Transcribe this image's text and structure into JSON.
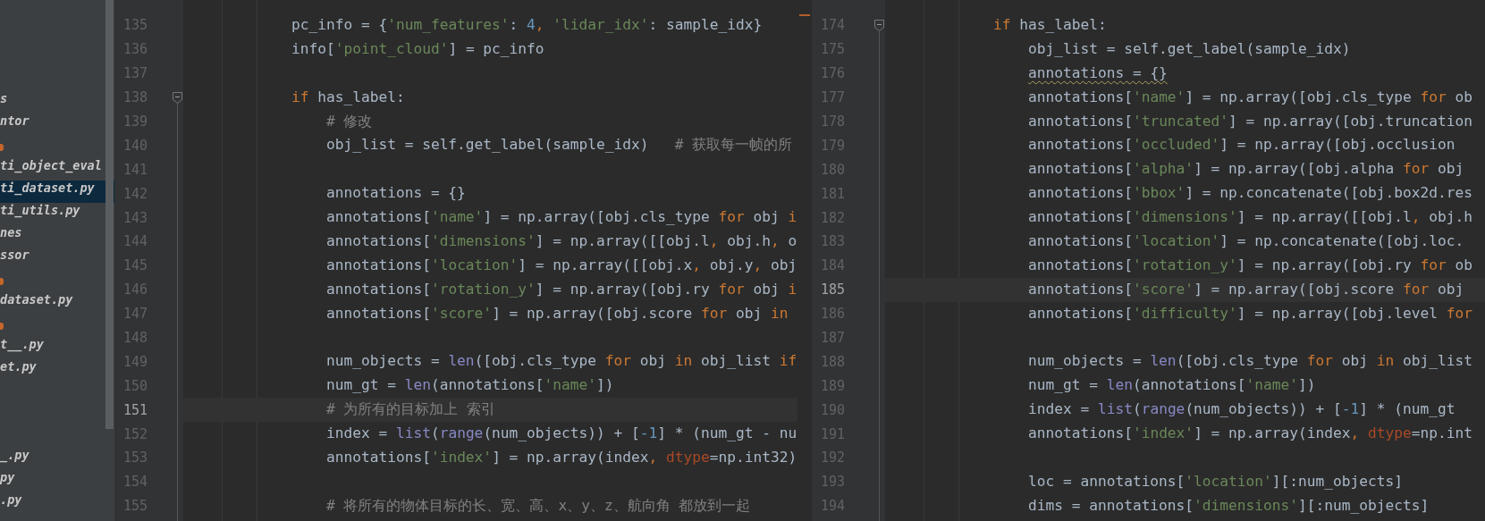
{
  "sidebar": {
    "groups": [
      {
        "items": [
          {
            "kind": "file",
            "label": "s",
            "selected": false
          },
          {
            "kind": "file",
            "label": "ntor",
            "selected": false
          },
          {
            "kind": "marker"
          },
          {
            "kind": "file",
            "label": "ti_object_eval",
            "selected": false
          },
          {
            "kind": "file",
            "label": "ti_dataset.py",
            "selected": true
          },
          {
            "kind": "file",
            "label": "ti_utils.py",
            "selected": false
          },
          {
            "kind": "file",
            "label": "nes",
            "selected": false
          },
          {
            "kind": "file",
            "label": "ssor",
            "selected": false
          },
          {
            "kind": "marker"
          },
          {
            "kind": "file",
            "label": "dataset.py",
            "selected": false
          },
          {
            "kind": "marker"
          },
          {
            "kind": "file",
            "label": "t__.py",
            "selected": false
          },
          {
            "kind": "file",
            "label": "et.py",
            "selected": false
          }
        ]
      },
      {
        "items": [
          {
            "kind": "file",
            "label": "_.py",
            "selected": false
          },
          {
            "kind": "file",
            "label": "py",
            "selected": false
          },
          {
            "kind": "file",
            "label": ".py",
            "selected": false
          }
        ]
      }
    ]
  },
  "panes": [
    {
      "lines": [
        {
          "number": "135",
          "current": false,
          "fold": false,
          "segments": [
            {
              "text": "            pc_info = {",
              "kind": "plain"
            },
            {
              "text": "'num_features'",
              "kind": "string"
            },
            {
              "text": ": ",
              "kind": "plain"
            },
            {
              "text": "4",
              "kind": "number"
            },
            {
              "text": ", ",
              "kind": "keyword"
            },
            {
              "text": "'lidar_idx'",
              "kind": "string"
            },
            {
              "text": ": sample_idx}",
              "kind": "plain"
            }
          ]
        },
        {
          "number": "136",
          "current": false,
          "fold": false,
          "segments": [
            {
              "text": "            info[",
              "kind": "plain"
            },
            {
              "text": "'point_cloud'",
              "kind": "string"
            },
            {
              "text": "] = pc_info",
              "kind": "plain"
            }
          ]
        },
        {
          "number": "137",
          "current": false,
          "fold": false
        },
        {
          "number": "138",
          "current": false,
          "fold": true,
          "segments": [
            {
              "text": "            if",
              "kind": "keyword"
            },
            {
              "text": " has_label:",
              "kind": "plain"
            }
          ]
        },
        {
          "number": "139",
          "current": false,
          "fold": false,
          "segments": [
            {
              "text": "                # 修改",
              "kind": "comment"
            }
          ]
        },
        {
          "number": "140",
          "current": false,
          "fold": false,
          "segments": [
            {
              "text": "                obj_list = self.get_label(sample_idx)   ",
              "kind": "plain"
            },
            {
              "text": "# 获取每一帧的所",
              "kind": "comment"
            }
          ]
        },
        {
          "number": "141",
          "current": false,
          "fold": false
        },
        {
          "number": "142",
          "current": false,
          "fold": false,
          "segments": [
            {
              "text": "                annotations = {}",
              "kind": "plain"
            }
          ]
        },
        {
          "number": "143",
          "current": false,
          "fold": false,
          "segments": [
            {
              "text": "                annotations[",
              "kind": "plain"
            },
            {
              "text": "'name'",
              "kind": "string"
            },
            {
              "text": "] = np.array([obj.cls_type ",
              "kind": "plain"
            },
            {
              "text": "for",
              "kind": "keyword"
            },
            {
              "text": " obj ",
              "kind": "plain"
            },
            {
              "text": "i",
              "kind": "keyword"
            }
          ]
        },
        {
          "number": "144",
          "current": false,
          "fold": false,
          "segments": [
            {
              "text": "                annotations[",
              "kind": "plain"
            },
            {
              "text": "'dimensions'",
              "kind": "string"
            },
            {
              "text": "] = np.array([[obj.l",
              "kind": "plain"
            },
            {
              "text": ", ",
              "kind": "keyword"
            },
            {
              "text": "obj.h",
              "kind": "plain"
            },
            {
              "text": ", ",
              "kind": "keyword"
            },
            {
              "text": "o",
              "kind": "plain"
            }
          ]
        },
        {
          "number": "145",
          "current": false,
          "fold": false,
          "segments": [
            {
              "text": "                annotations[",
              "kind": "plain"
            },
            {
              "text": "'location'",
              "kind": "string"
            },
            {
              "text": "] = np.array([[obj.x",
              "kind": "plain"
            },
            {
              "text": ", ",
              "kind": "keyword"
            },
            {
              "text": "obj.y",
              "kind": "plain"
            },
            {
              "text": ", ",
              "kind": "keyword"
            },
            {
              "text": "obj",
              "kind": "plain"
            }
          ]
        },
        {
          "number": "146",
          "current": false,
          "fold": false,
          "segments": [
            {
              "text": "                annotations[",
              "kind": "plain"
            },
            {
              "text": "'rotation_y'",
              "kind": "string"
            },
            {
              "text": "] = np.array([obj.ry ",
              "kind": "plain"
            },
            {
              "text": "for",
              "kind": "keyword"
            },
            {
              "text": " obj ",
              "kind": "plain"
            },
            {
              "text": "i",
              "kind": "keyword"
            }
          ]
        },
        {
          "number": "147",
          "current": false,
          "fold": false,
          "segments": [
            {
              "text": "                annotations[",
              "kind": "plain"
            },
            {
              "text": "'score'",
              "kind": "string"
            },
            {
              "text": "] = np.array([obj.score ",
              "kind": "plain"
            },
            {
              "text": "for",
              "kind": "keyword"
            },
            {
              "text": " obj ",
              "kind": "plain"
            },
            {
              "text": "in",
              "kind": "keyword"
            }
          ]
        },
        {
          "number": "148",
          "current": false,
          "fold": false
        },
        {
          "number": "149",
          "current": false,
          "fold": false,
          "segments": [
            {
              "text": "                num_objects = ",
              "kind": "plain"
            },
            {
              "text": "len",
              "kind": "builtin"
            },
            {
              "text": "([obj.cls_type ",
              "kind": "plain"
            },
            {
              "text": "for",
              "kind": "keyword"
            },
            {
              "text": " obj ",
              "kind": "plain"
            },
            {
              "text": "in",
              "kind": "keyword"
            },
            {
              "text": " obj_list ",
              "kind": "plain"
            },
            {
              "text": "if",
              "kind": "keyword"
            }
          ]
        },
        {
          "number": "150",
          "current": false,
          "fold": false,
          "segments": [
            {
              "text": "                num_gt = ",
              "kind": "plain"
            },
            {
              "text": "len",
              "kind": "builtin"
            },
            {
              "text": "(annotations[",
              "kind": "plain"
            },
            {
              "text": "'name'",
              "kind": "string"
            },
            {
              "text": "])",
              "kind": "plain"
            }
          ]
        },
        {
          "number": "151",
          "current": true,
          "fold": false,
          "segments": [
            {
              "text": "                # 为所有的目标加上 索引",
              "kind": "comment"
            }
          ]
        },
        {
          "number": "152",
          "current": false,
          "fold": false,
          "segments": [
            {
              "text": "                index = ",
              "kind": "plain"
            },
            {
              "text": "list",
              "kind": "builtin"
            },
            {
              "text": "(",
              "kind": "plain"
            },
            {
              "text": "range",
              "kind": "builtin"
            },
            {
              "text": "(num_objects)) + [",
              "kind": "plain"
            },
            {
              "text": "-1",
              "kind": "number"
            },
            {
              "text": "] * (num_gt - nu",
              "kind": "plain"
            }
          ]
        },
        {
          "number": "153",
          "current": false,
          "fold": false,
          "segments": [
            {
              "text": "                annotations[",
              "kind": "plain"
            },
            {
              "text": "'index'",
              "kind": "string"
            },
            {
              "text": "] = np.array(index",
              "kind": "plain"
            },
            {
              "text": ", ",
              "kind": "keyword"
            },
            {
              "text": "dtype",
              "kind": "param"
            },
            {
              "text": "=np.int32)",
              "kind": "plain"
            }
          ]
        },
        {
          "number": "154",
          "current": false,
          "fold": false
        },
        {
          "number": "155",
          "current": false,
          "fold": false,
          "segments": [
            {
              "text": "                # 将所有的物体目标的长、宽、高、x、y、z、航向角 都放到一起",
              "kind": "comment"
            }
          ]
        }
      ]
    },
    {
      "lines": [
        {
          "number": "174",
          "current": false,
          "fold": true,
          "segments": [
            {
              "text": "            if",
              "kind": "keyword"
            },
            {
              "text": " has_label:",
              "kind": "plain"
            }
          ]
        },
        {
          "number": "175",
          "current": false,
          "fold": false,
          "segments": [
            {
              "text": "                obj_list = self.get_label(sample_idx)",
              "kind": "plain"
            }
          ]
        },
        {
          "number": "176",
          "current": false,
          "fold": false,
          "segments": [
            {
              "text": "                annotations = {}",
              "kind": "warning"
            }
          ]
        },
        {
          "number": "177",
          "current": false,
          "fold": false,
          "segments": [
            {
              "text": "                annotations[",
              "kind": "plain"
            },
            {
              "text": "'name'",
              "kind": "string"
            },
            {
              "text": "] = np.array([obj.cls_type ",
              "kind": "plain"
            },
            {
              "text": "for",
              "kind": "keyword"
            },
            {
              "text": " ob",
              "kind": "plain"
            }
          ]
        },
        {
          "number": "178",
          "current": false,
          "fold": false,
          "segments": [
            {
              "text": "                annotations[",
              "kind": "plain"
            },
            {
              "text": "'truncated'",
              "kind": "string"
            },
            {
              "text": "] = np.array([obj.truncation",
              "kind": "plain"
            }
          ]
        },
        {
          "number": "179",
          "current": false,
          "fold": false,
          "segments": [
            {
              "text": "                annotations[",
              "kind": "plain"
            },
            {
              "text": "'occluded'",
              "kind": "string"
            },
            {
              "text": "] = np.array([obj.occlusion",
              "kind": "plain"
            }
          ]
        },
        {
          "number": "180",
          "current": false,
          "fold": false,
          "segments": [
            {
              "text": "                annotations[",
              "kind": "plain"
            },
            {
              "text": "'alpha'",
              "kind": "string"
            },
            {
              "text": "] = np.array([obj.alpha ",
              "kind": "plain"
            },
            {
              "text": "for",
              "kind": "keyword"
            },
            {
              "text": " obj",
              "kind": "plain"
            }
          ]
        },
        {
          "number": "181",
          "current": false,
          "fold": false,
          "segments": [
            {
              "text": "                annotations[",
              "kind": "plain"
            },
            {
              "text": "'bbox'",
              "kind": "string"
            },
            {
              "text": "] = np.concatenate([obj.box2d.res",
              "kind": "plain"
            }
          ]
        },
        {
          "number": "182",
          "current": false,
          "fold": false,
          "segments": [
            {
              "text": "                annotations[",
              "kind": "plain"
            },
            {
              "text": "'dimensions'",
              "kind": "string"
            },
            {
              "text": "] = np.array([[obj.l",
              "kind": "plain"
            },
            {
              "text": ", ",
              "kind": "keyword"
            },
            {
              "text": "obj.h",
              "kind": "plain"
            }
          ]
        },
        {
          "number": "183",
          "current": false,
          "fold": false,
          "segments": [
            {
              "text": "                annotations[",
              "kind": "plain"
            },
            {
              "text": "'location'",
              "kind": "string"
            },
            {
              "text": "] = np.concatenate([obj.loc.",
              "kind": "plain"
            }
          ]
        },
        {
          "number": "184",
          "current": false,
          "fold": false,
          "segments": [
            {
              "text": "                annotations[",
              "kind": "plain"
            },
            {
              "text": "'rotation_y'",
              "kind": "string"
            },
            {
              "text": "] = np.array([obj.ry ",
              "kind": "plain"
            },
            {
              "text": "for",
              "kind": "keyword"
            },
            {
              "text": " ob",
              "kind": "plain"
            }
          ]
        },
        {
          "number": "185",
          "current": true,
          "fold": false,
          "segments": [
            {
              "text": "                annotations[",
              "kind": "plain"
            },
            {
              "text": "'score'",
              "kind": "string"
            },
            {
              "text": "] = np.array([obj.score ",
              "kind": "plain"
            },
            {
              "text": "for",
              "kind": "keyword"
            },
            {
              "text": " obj",
              "kind": "plain"
            }
          ]
        },
        {
          "number": "186",
          "current": false,
          "fold": false,
          "segments": [
            {
              "text": "                annotations[",
              "kind": "plain"
            },
            {
              "text": "'difficulty'",
              "kind": "string"
            },
            {
              "text": "] = np.array([obj.level ",
              "kind": "plain"
            },
            {
              "text": "for",
              "kind": "keyword"
            }
          ]
        },
        {
          "number": "187",
          "current": false,
          "fold": false
        },
        {
          "number": "188",
          "current": false,
          "fold": false,
          "segments": [
            {
              "text": "                num_objects = ",
              "kind": "plain"
            },
            {
              "text": "len",
              "kind": "builtin"
            },
            {
              "text": "([obj.cls_type ",
              "kind": "plain"
            },
            {
              "text": "for",
              "kind": "keyword"
            },
            {
              "text": " obj ",
              "kind": "plain"
            },
            {
              "text": "in",
              "kind": "keyword"
            },
            {
              "text": " obj_list",
              "kind": "plain"
            }
          ]
        },
        {
          "number": "189",
          "current": false,
          "fold": false,
          "segments": [
            {
              "text": "                num_gt = ",
              "kind": "plain"
            },
            {
              "text": "len",
              "kind": "builtin"
            },
            {
              "text": "(annotations[",
              "kind": "plain"
            },
            {
              "text": "'name'",
              "kind": "string"
            },
            {
              "text": "])",
              "kind": "plain"
            }
          ]
        },
        {
          "number": "190",
          "current": false,
          "fold": false,
          "segments": [
            {
              "text": "                index = ",
              "kind": "plain"
            },
            {
              "text": "list",
              "kind": "builtin"
            },
            {
              "text": "(",
              "kind": "plain"
            },
            {
              "text": "range",
              "kind": "builtin"
            },
            {
              "text": "(num_objects)) + [",
              "kind": "plain"
            },
            {
              "text": "-1",
              "kind": "number"
            },
            {
              "text": "] * (num_gt",
              "kind": "plain"
            }
          ]
        },
        {
          "number": "191",
          "current": false,
          "fold": false,
          "segments": [
            {
              "text": "                annotations[",
              "kind": "plain"
            },
            {
              "text": "'index'",
              "kind": "string"
            },
            {
              "text": "] = np.array(index",
              "kind": "plain"
            },
            {
              "text": ", ",
              "kind": "keyword"
            },
            {
              "text": "dtype",
              "kind": "param"
            },
            {
              "text": "=np.int",
              "kind": "plain"
            }
          ]
        },
        {
          "number": "192",
          "current": false,
          "fold": false
        },
        {
          "number": "193",
          "current": false,
          "fold": false,
          "segments": [
            {
              "text": "                loc = annotations[",
              "kind": "plain"
            },
            {
              "text": "'location'",
              "kind": "string"
            },
            {
              "text": "][:num_objects]",
              "kind": "plain"
            }
          ]
        },
        {
          "number": "194",
          "current": false,
          "fold": false,
          "segments": [
            {
              "text": "                dims = annotations[",
              "kind": "plain"
            },
            {
              "text": "'dimensions'",
              "kind": "string"
            },
            {
              "text": "][:num_objects]",
              "kind": "plain"
            }
          ]
        }
      ]
    }
  ]
}
